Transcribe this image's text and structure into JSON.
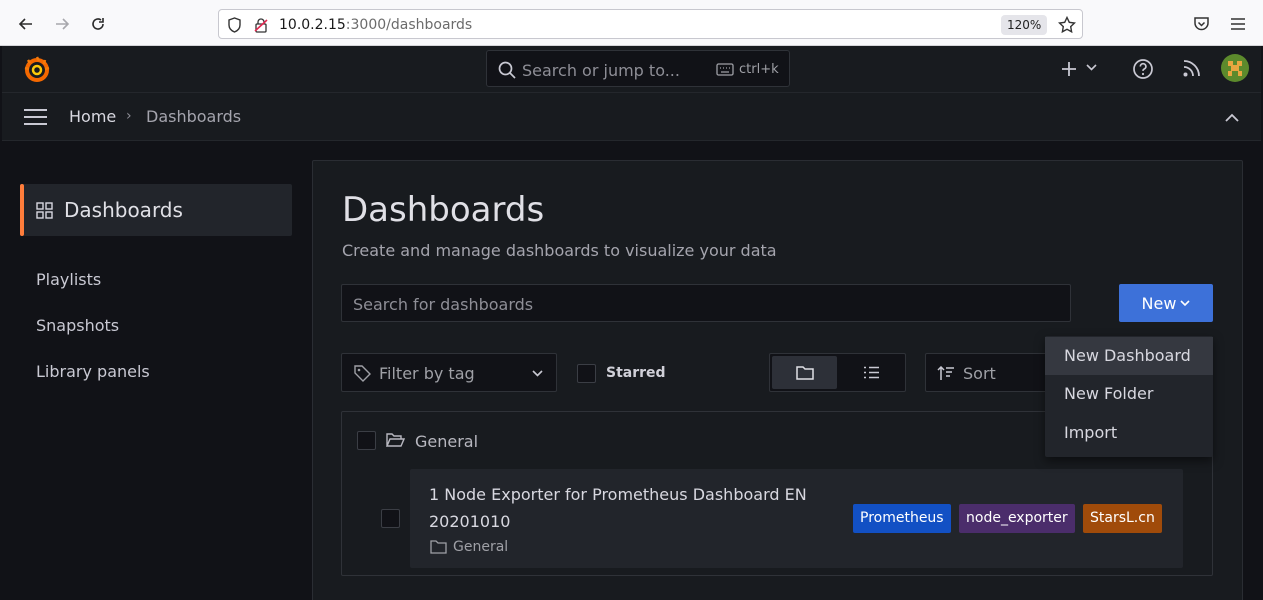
{
  "browser": {
    "url_host": "10.0.2.15",
    "url_rest": ":3000/dashboards",
    "zoom": "120%"
  },
  "topbar": {
    "search_placeholder": "Search or jump to...",
    "shortcut": "ctrl+k"
  },
  "breadcrumb": {
    "home": "Home",
    "separator": "›",
    "current": "Dashboards"
  },
  "sidebar": {
    "active": "Dashboards",
    "items": [
      "Playlists",
      "Snapshots",
      "Library panels"
    ]
  },
  "main": {
    "title": "Dashboards",
    "subtitle": "Create and manage dashboards to visualize your data",
    "search_placeholder": "Search for dashboards",
    "new_button": "New",
    "filter_tag": "Filter by tag",
    "starred": "Starred",
    "sort": "Sort"
  },
  "new_menu": {
    "items": [
      "New Dashboard",
      "New Folder",
      "Import"
    ]
  },
  "folder": {
    "name": "General"
  },
  "dashboards": [
    {
      "title": "1 Node Exporter for Prometheus Dashboard EN 20201010",
      "folder": "General",
      "tags": [
        {
          "label": "Prometheus",
          "color": "#1250c4"
        },
        {
          "label": "node_exporter",
          "color": "#4b2d6b"
        },
        {
          "label": "StarsL.cn",
          "color": "#a04b0a"
        }
      ]
    }
  ],
  "colors": {
    "accent_primary": "#3d71d9",
    "active_indicator": "#ff7d3b"
  }
}
